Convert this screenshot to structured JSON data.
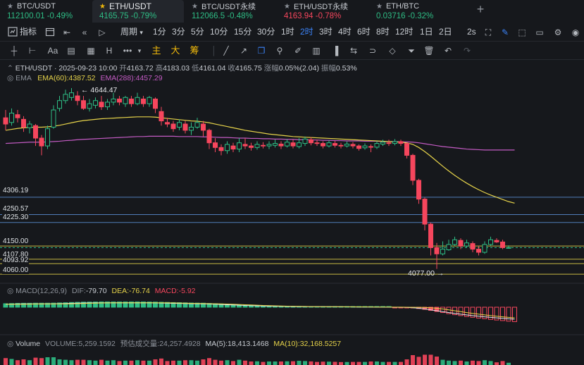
{
  "tickers": [
    {
      "symbol": "BTC/USDT",
      "price": "112100.01",
      "change": "-0.49%",
      "price_color": "#2ebd85",
      "change_color": "#2ebd85",
      "active": false
    },
    {
      "symbol": "ETH/USDT",
      "price": "4165.75",
      "change": "-0.79%",
      "price_color": "#2ebd85",
      "change_color": "#2ebd85",
      "active": true
    },
    {
      "symbol": "BTC/USDT永续",
      "price": "112066.5",
      "change": "-0.48%",
      "price_color": "#2ebd85",
      "change_color": "#2ebd85",
      "active": false
    },
    {
      "symbol": "ETH/USDT永续",
      "price": "4163.94",
      "change": "-0.78%",
      "price_color": "#f6465d",
      "change_color": "#f6465d",
      "active": false
    },
    {
      "symbol": "ETH/BTC",
      "price": "0.03716",
      "change": "-0.32%",
      "price_color": "#2ebd85",
      "change_color": "#2ebd85",
      "active": false
    }
  ],
  "add_tab_icon": "plus-icon",
  "toolbar": {
    "indicators_label": "指标",
    "period_label": "周期",
    "intervals": [
      "1分",
      "3分",
      "5分",
      "10分",
      "15分",
      "30分",
      "1时",
      "2时",
      "3时",
      "4时",
      "6时",
      "8时",
      "12时",
      "1日",
      "2日"
    ],
    "active_interval": "2时",
    "right_label": "2s"
  },
  "drawing_tools": {
    "text_tool": "Aa",
    "labels": [
      "主",
      "大",
      "筹"
    ]
  },
  "legend": {
    "symbol_line": "ETH/USDT · 2025-09-23 10:00",
    "open_label": "开",
    "open": "4163.72",
    "high_label": "高",
    "high": "4183.03",
    "low_label": "低",
    "low": "4161.04",
    "close_label": "收",
    "close": "4165.75",
    "change_label": "涨幅",
    "change": "0.05%(2.04)",
    "amp_label": "振幅",
    "amp": "0.53%",
    "ema_title": "EMA",
    "ema60_label": "EMA(60):",
    "ema60": "4387.52",
    "ema288_label": "EMA(288):",
    "ema288": "4457.29"
  },
  "annotations": {
    "high_marker": "← 4644.47",
    "low_marker": "4077.00 →"
  },
  "price_levels": [
    {
      "label": "4306.19",
      "price": 4306.19,
      "color": "#5b8fd6"
    },
    {
      "label": "4250.57",
      "price": 4250.57,
      "color": "#5b8fd6"
    },
    {
      "label": "4225.30",
      "price": 4225.3,
      "color": "#5b8fd6"
    },
    {
      "label": "4150.00",
      "price": 4150.0,
      "color": "#e6d34a"
    },
    {
      "label": "4107.80",
      "price": 4107.8,
      "color": "#e6d34a"
    },
    {
      "label": "4093.92",
      "price": 4093.92,
      "color": "#e6d34a"
    },
    {
      "label": "4060.00",
      "price": 4060.0,
      "color": "#e6d34a"
    }
  ],
  "macd": {
    "title": "MACD(12,26,9)",
    "dif_label": "DIF:",
    "dif": "-79.70",
    "dea_label": "DEA:",
    "dea": "-76.74",
    "macd_label": "MACD:",
    "macd": "-5.92"
  },
  "volume": {
    "title": "Volume",
    "volume_label": "VOLUME:",
    "volume": "5,259.1592",
    "estimate_label": "预估成交量:",
    "estimate": "24,257.4928",
    "ma5_label": "MA(5):",
    "ma5": "18,413.1468",
    "ma10_label": "MA(10):",
    "ma10": "32,168.5257"
  },
  "colors": {
    "up": "#2ebd85",
    "down": "#f6465d",
    "ema60": "#e6d34a",
    "ema288": "#c45bc4",
    "dif": "#e6e8eb",
    "dea": "#e6d34a",
    "accent": "#3b82f6"
  },
  "chart_data": {
    "type": "candlestick",
    "price_range": [
      4040,
      4700
    ],
    "candles": [
      [
        4560,
        4540,
        4585,
        4520
      ],
      [
        4545,
        4575,
        4590,
        4535
      ],
      [
        4570,
        4560,
        4585,
        4545
      ],
      [
        4555,
        4530,
        4565,
        4515
      ],
      [
        4528,
        4540,
        4550,
        4510
      ],
      [
        4535,
        4495,
        4540,
        4470
      ],
      [
        4495,
        4470,
        4505,
        4440
      ],
      [
        4470,
        4525,
        4535,
        4460
      ],
      [
        4530,
        4585,
        4600,
        4525
      ],
      [
        4590,
        4615,
        4630,
        4580
      ],
      [
        4615,
        4635,
        4650,
        4605
      ],
      [
        4625,
        4640,
        4655,
        4615
      ],
      [
        4630,
        4615,
        4645,
        4600
      ],
      [
        4615,
        4590,
        4630,
        4585
      ],
      [
        4590,
        4605,
        4620,
        4580
      ],
      [
        4600,
        4615,
        4625,
        4590
      ],
      [
        4610,
        4595,
        4630,
        4585
      ],
      [
        4595,
        4610,
        4620,
        4585
      ],
      [
        4610,
        4620,
        4640,
        4600
      ],
      [
        4620,
        4610,
        4630,
        4600
      ],
      [
        4605,
        4625,
        4630,
        4595
      ],
      [
        4620,
        4605,
        4630,
        4595
      ],
      [
        4605,
        4625,
        4640,
        4600
      ],
      [
        4620,
        4605,
        4630,
        4595
      ],
      [
        4605,
        4625,
        4630,
        4595
      ],
      [
        4620,
        4590,
        4625,
        4575
      ],
      [
        4580,
        4550,
        4595,
        4535
      ],
      [
        4545,
        4540,
        4560,
        4530
      ],
      [
        4540,
        4525,
        4550,
        4515
      ],
      [
        4530,
        4545,
        4555,
        4520
      ],
      [
        4540,
        4520,
        4550,
        4510
      ],
      [
        4520,
        4530,
        4545,
        4505
      ],
      [
        4530,
        4545,
        4560,
        4525
      ],
      [
        4540,
        4520,
        4550,
        4500
      ],
      [
        4520,
        4480,
        4525,
        4460
      ],
      [
        4480,
        4465,
        4495,
        4450
      ],
      [
        4465,
        4455,
        4475,
        4440
      ],
      [
        4455,
        4475,
        4485,
        4445
      ],
      [
        4470,
        4460,
        4480,
        4450
      ],
      [
        4460,
        4480,
        4495,
        4450
      ],
      [
        4475,
        4470,
        4495,
        4460
      ],
      [
        4470,
        4465,
        4480,
        4455
      ],
      [
        4465,
        4475,
        4485,
        4458
      ],
      [
        4472,
        4470,
        4482,
        4462
      ],
      [
        4470,
        4475,
        4485,
        4460
      ],
      [
        4472,
        4478,
        4490,
        4465
      ],
      [
        4476,
        4470,
        4485,
        4460
      ],
      [
        4470,
        4482,
        4492,
        4465
      ],
      [
        4480,
        4470,
        4490,
        4462
      ],
      [
        4468,
        4480,
        4495,
        4462
      ],
      [
        4478,
        4492,
        4500,
        4470
      ],
      [
        4490,
        4480,
        4498,
        4472
      ],
      [
        4480,
        4478,
        4490,
        4470
      ],
      [
        4478,
        4470,
        4485,
        4462
      ],
      [
        4470,
        4480,
        4488,
        4465
      ],
      [
        4478,
        4472,
        4486,
        4465
      ],
      [
        4472,
        4470,
        4480,
        4462
      ],
      [
        4470,
        4476,
        4484,
        4465
      ],
      [
        4475,
        4470,
        4482,
        4462
      ],
      [
        4470,
        4462,
        4475,
        4455
      ],
      [
        4464,
        4470,
        4478,
        4458
      ],
      [
        4468,
        4466,
        4475,
        4450
      ],
      [
        4466,
        4478,
        4485,
        4460
      ],
      [
        4476,
        4482,
        4490,
        4470
      ],
      [
        4480,
        4478,
        4490,
        4470
      ],
      [
        4478,
        4484,
        4492,
        4472
      ],
      [
        4484,
        4478,
        4490,
        4470
      ],
      [
        4478,
        4440,
        4480,
        4430
      ],
      [
        4440,
        4360,
        4445,
        4345
      ],
      [
        4360,
        4300,
        4365,
        4285
      ],
      [
        4300,
        4220,
        4305,
        4200
      ],
      [
        4220,
        4145,
        4225,
        4120
      ],
      [
        4145,
        4125,
        4160,
        4077
      ],
      [
        4125,
        4140,
        4165,
        4120
      ],
      [
        4138,
        4155,
        4170,
        4135
      ],
      [
        4155,
        4170,
        4180,
        4150
      ],
      [
        4168,
        4150,
        4175,
        4140
      ],
      [
        4150,
        4160,
        4170,
        4145
      ],
      [
        4158,
        4140,
        4165,
        4130
      ],
      [
        4140,
        4130,
        4150,
        4120
      ],
      [
        4130,
        4155,
        4165,
        4125
      ],
      [
        4155,
        4170,
        4180,
        4150
      ],
      [
        4168,
        4163,
        4175,
        4160
      ],
      [
        4163,
        4145,
        4170,
        4140
      ],
      [
        4145,
        4145,
        4152,
        4142
      ]
    ],
    "ema60": [
      4520,
      4523,
      4526,
      4528,
      4529,
      4530,
      4530,
      4531,
      4533,
      4536,
      4540,
      4544,
      4548,
      4551,
      4553,
      4555,
      4557,
      4558,
      4559,
      4560,
      4561,
      4562,
      4563,
      4563,
      4563,
      4562,
      4560,
      4558,
      4556,
      4554,
      4552,
      4550,
      4549,
      4547,
      4544,
      4540,
      4536,
      4532,
      4528,
      4524,
      4520,
      4517,
      4514,
      4511,
      4508,
      4506,
      4504,
      4502,
      4500,
      4499,
      4498,
      4497,
      4496,
      4495,
      4494,
      4493,
      4492,
      4491,
      4490,
      4489,
      4488,
      4487,
      4486,
      4485,
      4484,
      4483,
      4482,
      4480,
      4475,
      4465,
      4452,
      4437,
      4421,
      4405,
      4390,
      4376,
      4363,
      4351,
      4340,
      4330,
      4321,
      4313,
      4306,
      4299,
      4292,
      4287
    ],
    "ema288": [
      4478,
      4479,
      4480,
      4481,
      4482,
      4482,
      4482,
      4483,
      4484,
      4485,
      4487,
      4488,
      4490,
      4491,
      4492,
      4493,
      4494,
      4495,
      4496,
      4497,
      4498,
      4499,
      4500,
      4500,
      4501,
      4501,
      4501,
      4501,
      4501,
      4500,
      4500,
      4500,
      4500,
      4499,
      4499,
      4498,
      4497,
      4497,
      4496,
      4495,
      4495,
      4494,
      4494,
      4493,
      4493,
      4492,
      4492,
      4491,
      4491,
      4490,
      4490,
      4489,
      4489,
      4488,
      4488,
      4487,
      4487,
      4486,
      4486,
      4486,
      4485,
      4485,
      4485,
      4484,
      4484,
      4484,
      4483,
      4483,
      4482,
      4480,
      4477,
      4474,
      4471,
      4468,
      4466,
      4464,
      4462,
      4460,
      4459,
      4458,
      4457,
      4457,
      4457,
      4457,
      4457,
      4457
    ]
  }
}
